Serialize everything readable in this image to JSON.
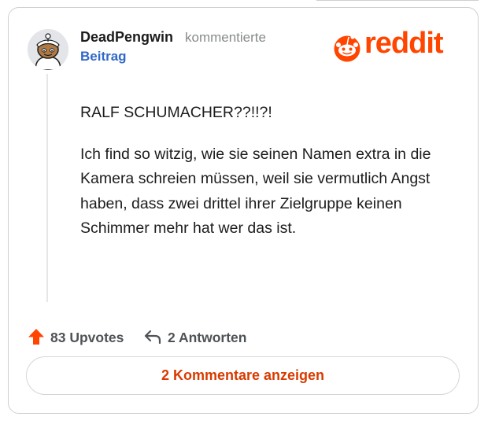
{
  "comment": {
    "username": "DeadPengwin",
    "action": "kommentierte",
    "post_link": "Beitrag",
    "paragraphs": [
      "RALF SCHUMACHER??!!?!",
      "Ich find so witzig, wie sie seinen Namen extra in die Kamera schreien müssen, weil sie vermutlich Angst haben, dass zwei drittel ihrer Zielgruppe keinen Schimmer mehr hat wer das ist."
    ],
    "upvotes": "83 Upvotes",
    "replies": "2 Antworten",
    "show_comments": "2 Kommentare anzeigen"
  },
  "brand": {
    "wordmark": "reddit"
  },
  "colors": {
    "reddit_orange": "#ff4500",
    "link_blue": "#3168c9",
    "button_text": "#d93a00",
    "stat_gray": "#4f5356"
  },
  "icons": {
    "avatar": "snoo-avatar",
    "brand": "reddit-snoo-icon",
    "upvote": "upvote-arrow-icon",
    "reply": "reply-arrow-icon"
  }
}
